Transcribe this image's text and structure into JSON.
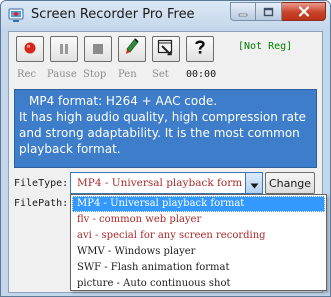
{
  "window": {
    "title": "Screen Recorder Pro Free"
  },
  "toolbar": {
    "buttons": [
      {
        "name": "record",
        "icon": "record-dot-icon",
        "color": "#d9261c"
      },
      {
        "name": "pause",
        "icon": "pause-icon"
      },
      {
        "name": "stop",
        "icon": "stop-square-icon"
      },
      {
        "name": "pen",
        "icon": "pen-icon"
      },
      {
        "name": "settings",
        "icon": "settings-icon"
      },
      {
        "name": "help",
        "icon": "question-mark-icon"
      }
    ],
    "labels": {
      "rec": "Rec",
      "pause": "Pause",
      "stop": "Stop",
      "pen": "Pen",
      "set": "Set"
    },
    "timer": "00:00",
    "reg_status": "[Not Reg]",
    "reg_status_color": "#008000"
  },
  "info": {
    "line1": "MP4 format: H264 + AAC code.",
    "line2": "It has high audio quality, high compression rate and strong adaptability. It is the most common playback format.",
    "background": "#3d7dc9"
  },
  "form": {
    "filetype_label": "FileType:",
    "filepath_label": "FilePath:",
    "filetype_selected": "MP4 - Universal playback format",
    "change_label": "Change"
  },
  "dropdown": {
    "highlight_color": "#3399ff",
    "options": [
      "MP4 - Universal playback format",
      "flv - common web player",
      "avi - special for any screen recording",
      "WMV - Windows player",
      "SWF - Flash animation format",
      "picture - Auto continuous shot"
    ]
  }
}
